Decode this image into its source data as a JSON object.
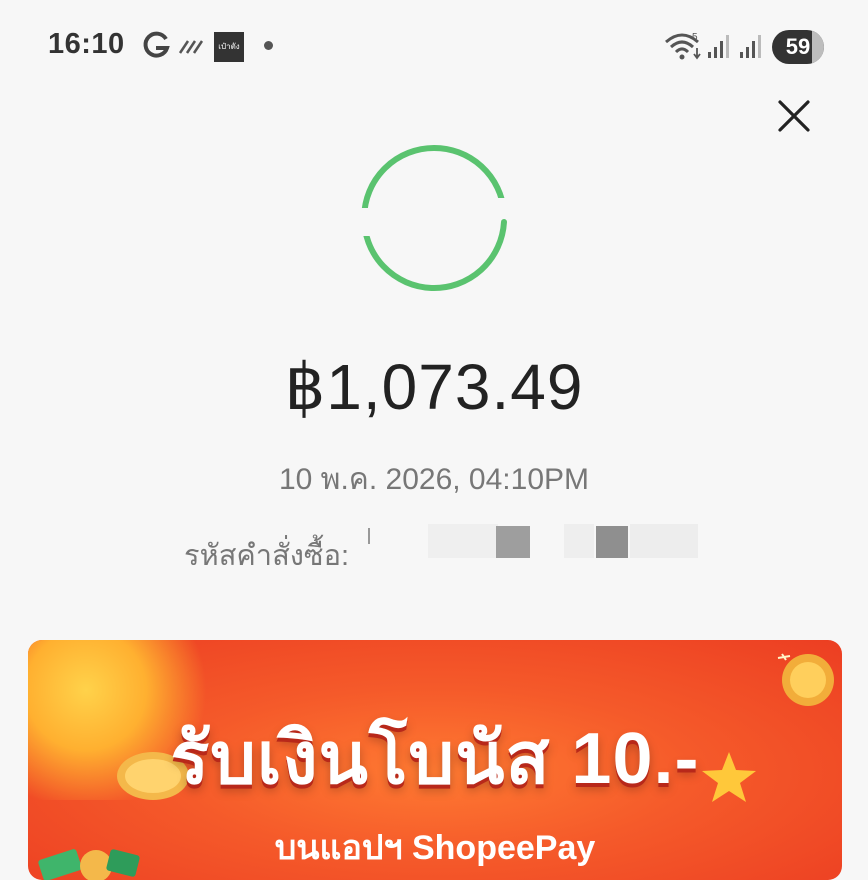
{
  "status_bar": {
    "time": "16:10",
    "app_icon_text": "เป๋าตัง",
    "battery_level": "59",
    "icons": [
      "google-icon",
      "dashes-icon",
      "app-icon",
      "dot-icon",
      "wifi-icon",
      "signal-icon",
      "signal-icon",
      "battery-icon"
    ]
  },
  "close_icon": "close-icon",
  "spinner": {
    "color": "#5ac36f",
    "icon": "loading-spinner-icon"
  },
  "payment": {
    "amount": "฿1,073.49",
    "datetime": "10 พ.ค. 2026, 04:10PM",
    "order_label": "รหัสคำสั่งซื้อ:"
  },
  "banner": {
    "headline": "รับเงินโบนัส 10.-",
    "subline": "บนแอปฯ ShopeePay",
    "colors": {
      "bg_center": "#ff7a32",
      "bg_edge": "#ec3e22",
      "text": "#ffffff",
      "accent": "#ffc83a"
    }
  }
}
